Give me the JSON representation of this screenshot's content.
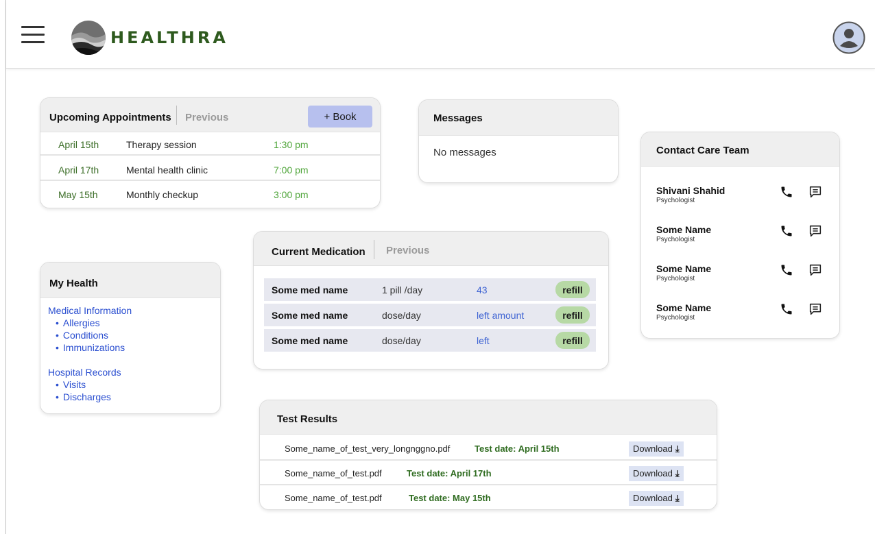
{
  "header": {
    "brand": "HEALTHRA",
    "icons": {
      "menu": "hamburger-menu-icon",
      "logo": "healthra-logo",
      "profile": "user-avatar-icon"
    }
  },
  "appointments": {
    "title": "Upcoming Appointments",
    "tab_previous": "Previous",
    "book_label": "+ Book",
    "items": [
      {
        "date": "April 15th",
        "desc": "Therapy session",
        "time": "1:30 pm"
      },
      {
        "date": "April 17th",
        "desc": "Mental health clinic",
        "time": "7:00 pm"
      },
      {
        "date": "May 15th",
        "desc": "Monthly checkup",
        "time": "3:00 pm"
      }
    ]
  },
  "messages": {
    "title": "Messages",
    "empty_text": "No messages"
  },
  "care_team": {
    "title": "Contact Care Team",
    "contacts": [
      {
        "name": "Shivani Shahid",
        "role": "Psychologist"
      },
      {
        "name": "Some Name",
        "role": "Psychologist"
      },
      {
        "name": "Some Name",
        "role": "Psychologist"
      },
      {
        "name": "Some Name",
        "role": "Psychologist"
      }
    ]
  },
  "my_health": {
    "title": "My Health",
    "sections": [
      {
        "label": "Medical Information",
        "items": [
          "Allergies",
          "Conditions",
          "Immunizations"
        ]
      },
      {
        "label": "Hospital Records",
        "items": [
          "Visits",
          "Discharges"
        ]
      }
    ]
  },
  "medication": {
    "title": "Current Medication",
    "tab_previous": "Previous",
    "refill_label": "refill",
    "items": [
      {
        "name": "Some med name",
        "dose": "1 pill /day",
        "left": "43"
      },
      {
        "name": "Some med name",
        "dose": "dose/day",
        "left": "left amount"
      },
      {
        "name": "Some med name",
        "dose": "dose/day",
        "left": "left"
      }
    ]
  },
  "test_results": {
    "title": "Test Results",
    "download_label": "Download",
    "items": [
      {
        "file": "Some_name_of_test_very_longnggno.pdf",
        "date": "Test date: April 15th"
      },
      {
        "file": "Some_name_of_test.pdf",
        "date": "Test date: April 17th"
      },
      {
        "file": "Some_name_of_test.pdf",
        "date": "Test date: May 15th"
      }
    ]
  },
  "colors": {
    "brand_green": "#2e5a1e",
    "link_blue": "#2a4ed0",
    "book_button": "#b7c0ee",
    "refill_badge": "#b7d9a5",
    "download_button": "#dde3f3"
  }
}
